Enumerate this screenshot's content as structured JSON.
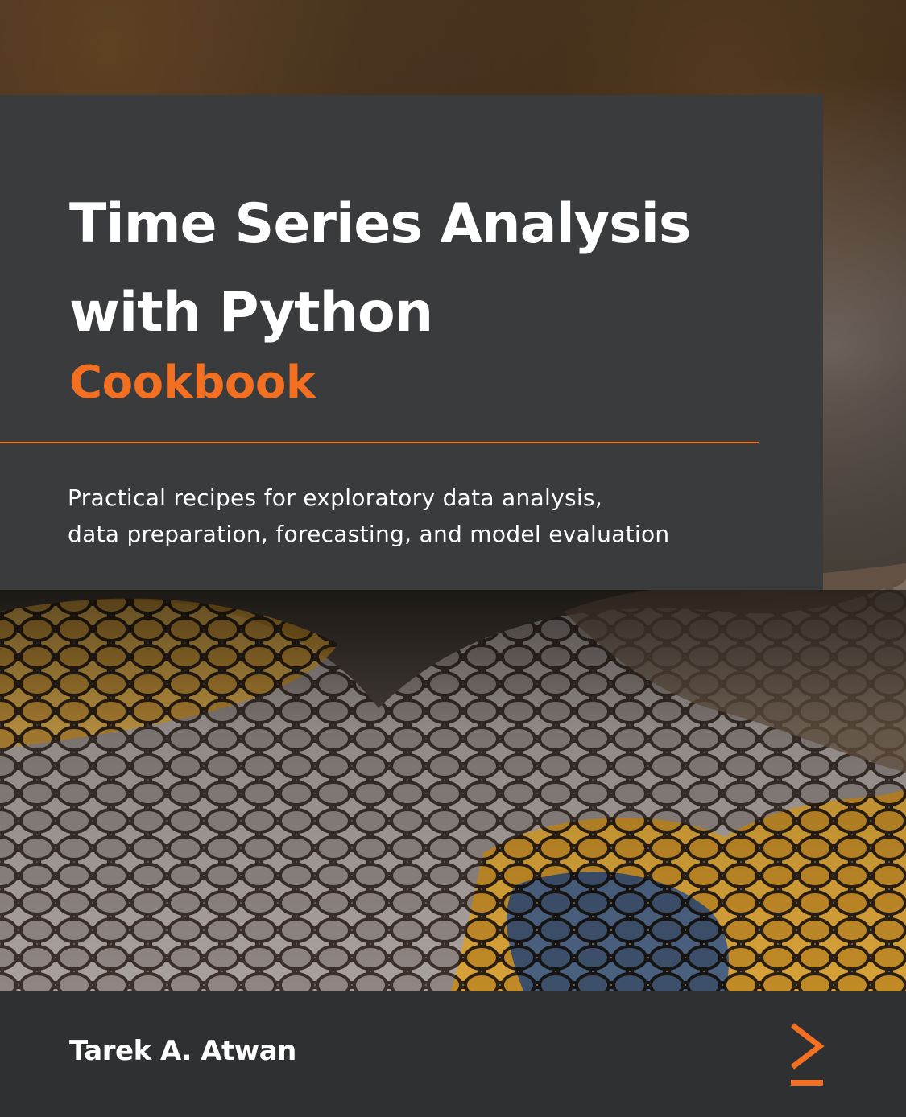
{
  "cover": {
    "title_line1": "Time Series Analysis",
    "title_line2": "with Python",
    "subtitle": "Cookbook",
    "tagline_line1": "Practical recipes for exploratory data analysis,",
    "tagline_line2": "data preparation, forecasting, and model evaluation",
    "author": "Tarek A. Atwan"
  },
  "colors": {
    "accent": "#f36f21",
    "panel": "#3a3b3d",
    "footer": "#2f3032"
  },
  "icons": {
    "publisher_logo": "chevron-right-underscore-icon",
    "background": "snake-scales-photo"
  }
}
